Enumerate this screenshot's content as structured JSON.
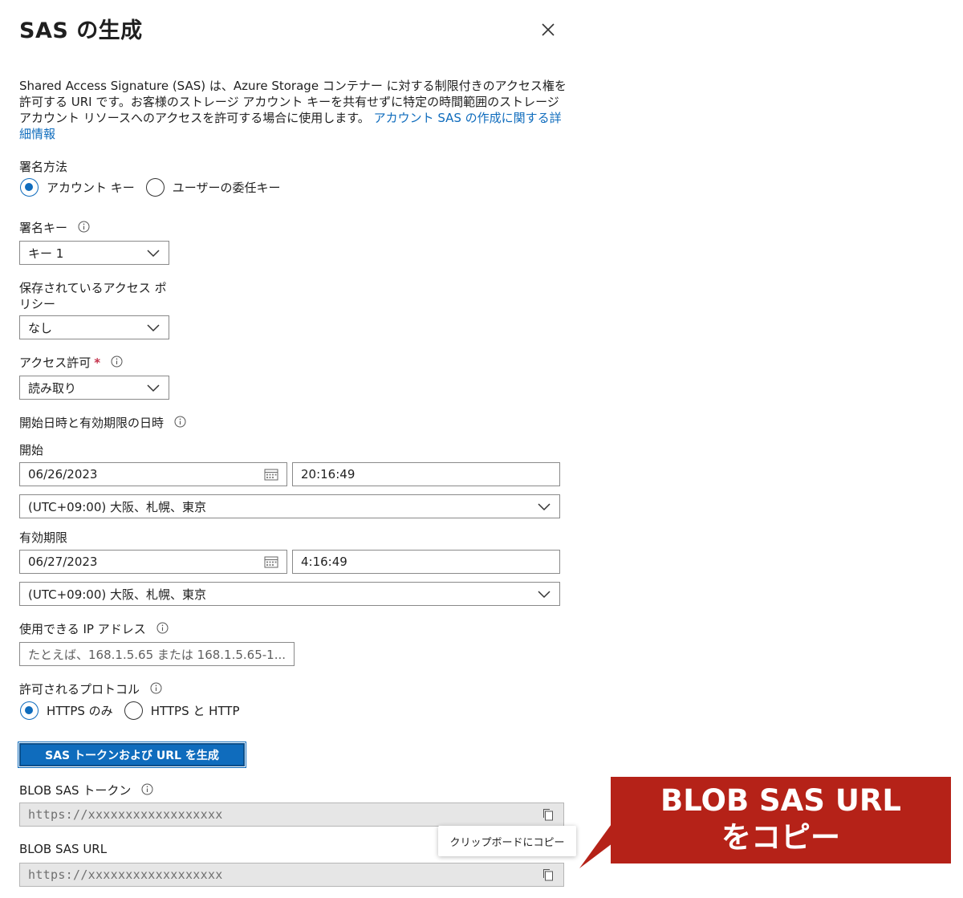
{
  "panel": {
    "title": "SAS の生成",
    "description": "Shared Access Signature (SAS) は、Azure Storage コンテナー に対する制限付きのアクセス権を許可する URI です。お客様のストレージ アカウント キーを共有せずに特定の時間範囲のストレージ アカウント リソースへのアクセスを許可する場合に使用します。",
    "description_link": "アカウント SAS の作成に関する詳細情報"
  },
  "signing_method": {
    "label": "署名方法",
    "options": [
      {
        "label": "アカウント キー",
        "checked": true
      },
      {
        "label": "ユーザーの委任キー",
        "checked": false
      }
    ]
  },
  "signing_key": {
    "label": "署名キー",
    "value": "キー 1"
  },
  "stored_policy": {
    "label_line1": "保存されているアクセス ポ",
    "label_line2": "リシー",
    "value": "なし"
  },
  "permissions": {
    "label": "アクセス許可",
    "required_mark": "*",
    "value": "読み取り"
  },
  "datetime": {
    "section_label": "開始日時と有効期限の日時",
    "start": {
      "label": "開始",
      "date": "06/26/2023",
      "time": "20:16:49",
      "timezone": "(UTC+09:00) 大阪、札幌、東京"
    },
    "expiry": {
      "label": "有効期限",
      "date": "06/27/2023",
      "time": "4:16:49",
      "timezone": "(UTC+09:00) 大阪、札幌、東京"
    }
  },
  "allowed_ip": {
    "label": "使用できる IP アドレス",
    "placeholder": "たとえば、168.1.5.65 または 168.1.5.65-1..."
  },
  "protocol": {
    "label": "許可されるプロトコル",
    "options": [
      {
        "label": "HTTPS のみ",
        "checked": true
      },
      {
        "label": "HTTPS と HTTP",
        "checked": false
      }
    ]
  },
  "generate_button": {
    "label": "SAS トークンおよび URL を生成"
  },
  "blob_sas_token": {
    "label": "BLOB SAS トークン",
    "value": "https://xxxxxxxxxxxxxxxxxx"
  },
  "blob_sas_url": {
    "label": "BLOB SAS URL",
    "value": "https://xxxxxxxxxxxxxxxxxx"
  },
  "tooltip": {
    "text": "クリップボードにコピー"
  },
  "callout": {
    "line1": "BLOB SAS URL",
    "line2": "をコピー",
    "color": "#b52218"
  },
  "colors": {
    "accent": "#0f6cbd",
    "required": "#c4314b"
  }
}
